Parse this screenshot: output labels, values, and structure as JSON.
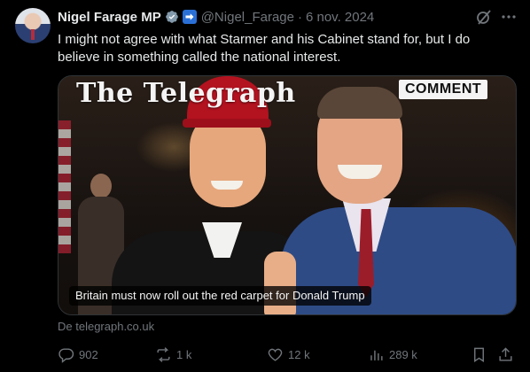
{
  "author": {
    "name": "Nigel Farage MP",
    "handle": "@Nigel_Farage",
    "separator": "·",
    "date": "6 nov. 2024"
  },
  "tweet": {
    "text": "I might not agree with what Starmer and his Cabinet stand for, but I do believe in something called the national interest."
  },
  "card": {
    "masthead": "The Telegraph",
    "badge": "COMMENT",
    "caption": "Britain must now roll out the red carpet for Donald Trump",
    "source": "De telegraph.co.uk"
  },
  "actions": {
    "replies": "902",
    "reposts": "1 k",
    "likes": "12 k",
    "views": "289 k"
  },
  "colors": {
    "background": "#000000",
    "text": "#e7e9ea",
    "muted": "#71767b",
    "verified": "#829aab",
    "border": "#2f3336"
  },
  "icons": {
    "verified": "verified-badge-icon",
    "affiliation": "affiliation-badge-icon",
    "grok": "grok-icon",
    "more": "more-icon",
    "reply": "reply-icon",
    "repost": "repost-icon",
    "like": "like-icon",
    "views": "views-icon",
    "bookmark": "bookmark-icon",
    "share": "share-icon"
  }
}
